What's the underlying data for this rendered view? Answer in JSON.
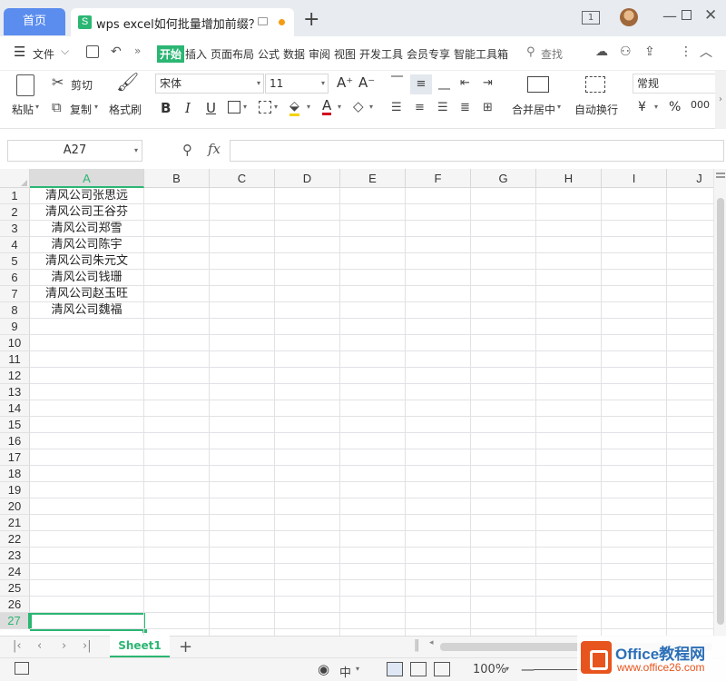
{
  "titlebar": {
    "home_tab": "首页",
    "doc_tab_title": "wps excel如何批量增加前缀？",
    "doc_icon": "S",
    "new_tab": "+",
    "window_count": "1"
  },
  "menubar": {
    "file": "文件",
    "tabs": [
      "开始",
      "插入",
      "页面布局",
      "公式",
      "数据",
      "审阅",
      "视图",
      "开发工具",
      "会员专享",
      "智能工具箱"
    ],
    "search": "查找"
  },
  "ribbon": {
    "paste": "粘贴",
    "cut": "剪切",
    "copy": "复制",
    "format_painter": "格式刷",
    "font_name": "宋体",
    "font_size": "11",
    "bold": "B",
    "italic": "I",
    "underline": "U",
    "merge_center": "合并居中",
    "wrap_text": "自动换行",
    "number_format": "常规",
    "currency": "¥",
    "percent": "%",
    "thousands": "000"
  },
  "formulabar": {
    "cell_ref": "A27",
    "fx": "fx",
    "formula": ""
  },
  "grid": {
    "columns": [
      "A",
      "B",
      "C",
      "D",
      "E",
      "F",
      "G",
      "H",
      "I",
      "J"
    ],
    "rows": [
      "1",
      "2",
      "3",
      "4",
      "5",
      "6",
      "7",
      "8",
      "9",
      "10",
      "11",
      "12",
      "13",
      "14",
      "15",
      "16",
      "17",
      "18",
      "19",
      "20",
      "21",
      "22",
      "23",
      "24",
      "25",
      "26",
      "27"
    ],
    "column_a_values": [
      "清风公司张思远",
      "清风公司王谷芬",
      "清风公司郑雪",
      "清风公司陈宇",
      "清风公司朱元文",
      "清风公司钱珊",
      "清风公司赵玉旺",
      "清风公司魏福"
    ],
    "selected_column": "A",
    "selected_row": "27"
  },
  "sheets": {
    "active": "Sheet1",
    "add": "+"
  },
  "statusbar": {
    "zoom": "100%",
    "input_mode": "中"
  },
  "watermark": {
    "title": "Office教程网",
    "url": "www.office26.com"
  },
  "colors": {
    "accent_green": "#2bb673",
    "home_tab_blue": "#5b8def",
    "watermark_orange": "#e8541e"
  }
}
